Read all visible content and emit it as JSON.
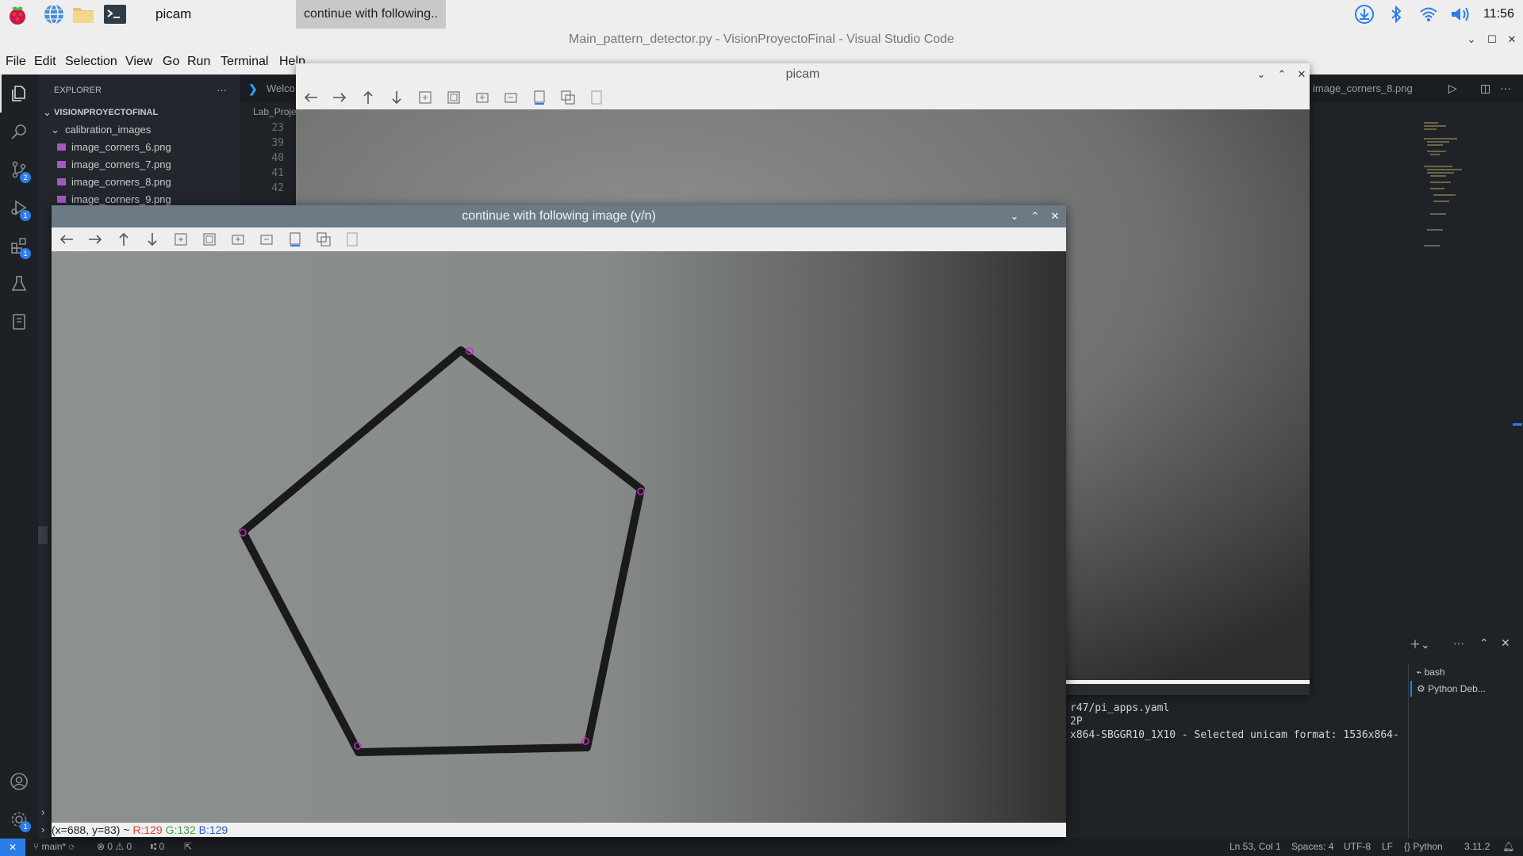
{
  "taskbar": {
    "app_label": "picam",
    "window_label": "continue with following..",
    "clock": "11:56"
  },
  "vscode": {
    "title": "Main_pattern_detector.py - VisionProyectoFinal - Visual Studio Code",
    "menu": [
      "File",
      "Edit",
      "Selection",
      "View",
      "Go",
      "Run",
      "Terminal",
      "Help"
    ],
    "explorer": {
      "header": "EXPLORER",
      "more": "···",
      "root": "VISIONPROYECTOFINAL",
      "folder": "calibration_images",
      "files": [
        "image_corners_6.png",
        "image_corners_7.png",
        "image_corners_8.png",
        "image_corners_9.png"
      ]
    },
    "badges": {
      "scm": "2",
      "debug": "1",
      "extensions": "1",
      "settings": "1"
    },
    "tabs": {
      "welcome": "Welco",
      "lab": "Lab_Proje",
      "right_tab": "image_corners_8.png"
    },
    "line_numbers": [
      "23",
      "39",
      "40",
      "41",
      "42"
    ],
    "terminal": {
      "lines": [
        "r47/pi_apps.yaml",
        "2P",
        "x864-SBGGR10_1X10 - Selected unicam format: 1536x864-"
      ],
      "sessions": [
        "bash",
        "Python Deb..."
      ]
    },
    "status": {
      "branch": "main*",
      "errors": "0",
      "warnings": "0",
      "ports": "0",
      "position": "Ln 53, Col 1",
      "spaces": "Spaces: 4",
      "encoding": "UTF-8",
      "eol": "LF",
      "language": "Python",
      "version": "3.11.2"
    }
  },
  "picam_window": {
    "title": "picam"
  },
  "dialog_window": {
    "title": "continue with following image (y/n)",
    "status": {
      "coords": "(x=688, y=83) ~",
      "r": "R:129",
      "g": "G:132",
      "b": "B:129"
    }
  },
  "colors": {
    "accent": "#2b7de9",
    "corner_marker": "#c030c0",
    "pentagon": "#1a1a1a"
  }
}
